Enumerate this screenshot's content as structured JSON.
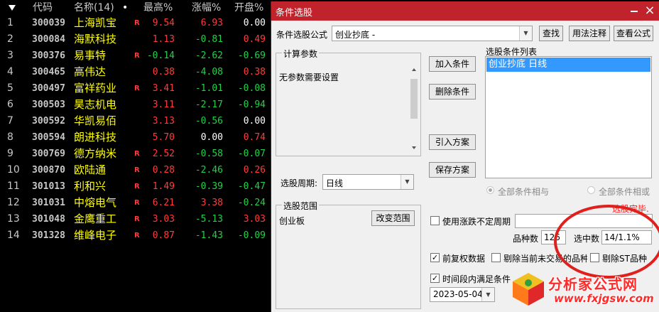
{
  "table": {
    "headers": {
      "code": "代码",
      "name": "名称(14)",
      "high": "最高%",
      "pct": "涨幅%",
      "open": "开盘%"
    },
    "rows": [
      {
        "idx": "1",
        "code": "300039",
        "name": "上海凯宝",
        "r": "R",
        "high": "9.54",
        "pct": "6.93",
        "open": "0.00",
        "hc": "red",
        "pc": "red",
        "oc": "white"
      },
      {
        "idx": "2",
        "code": "300084",
        "name": "海默科技",
        "r": "",
        "high": "1.13",
        "pct": "-0.81",
        "open": "0.49",
        "hc": "red",
        "pc": "green",
        "oc": "red"
      },
      {
        "idx": "3",
        "code": "300376",
        "name": "易事特",
        "r": "R",
        "high": "-0.14",
        "pct": "-2.62",
        "open": "-0.69",
        "hc": "green",
        "pc": "green",
        "oc": "green"
      },
      {
        "idx": "4",
        "code": "300465",
        "name": "高伟达",
        "r": "",
        "high": "0.38",
        "pct": "-4.08",
        "open": "0.38",
        "hc": "red",
        "pc": "green",
        "oc": "red"
      },
      {
        "idx": "5",
        "code": "300497",
        "name": "富祥药业",
        "r": "R",
        "high": "3.41",
        "pct": "-1.01",
        "open": "-0.08",
        "hc": "red",
        "pc": "green",
        "oc": "green"
      },
      {
        "idx": "6",
        "code": "300503",
        "name": "昊志机电",
        "r": "",
        "high": "3.11",
        "pct": "-2.17",
        "open": "-0.94",
        "hc": "red",
        "pc": "green",
        "oc": "green"
      },
      {
        "idx": "7",
        "code": "300592",
        "name": "华凯易佰",
        "r": "",
        "high": "3.13",
        "pct": "-0.56",
        "open": "0.00",
        "hc": "red",
        "pc": "green",
        "oc": "white"
      },
      {
        "idx": "8",
        "code": "300594",
        "name": "朗进科技",
        "r": "",
        "high": "5.70",
        "pct": "0.00",
        "open": "0.74",
        "hc": "red",
        "pc": "white",
        "oc": "red"
      },
      {
        "idx": "9",
        "code": "300769",
        "name": "德方纳米",
        "r": "R",
        "high": "2.52",
        "pct": "-0.58",
        "open": "-0.07",
        "hc": "red",
        "pc": "green",
        "oc": "green"
      },
      {
        "idx": "10",
        "code": "300870",
        "name": "欧陆通",
        "r": "R",
        "high": "0.28",
        "pct": "-2.46",
        "open": "0.26",
        "hc": "red",
        "pc": "green",
        "oc": "red"
      },
      {
        "idx": "11",
        "code": "301013",
        "name": "利和兴",
        "r": "R",
        "high": "1.49",
        "pct": "-0.39",
        "open": "-0.47",
        "hc": "red",
        "pc": "green",
        "oc": "green"
      },
      {
        "idx": "12",
        "code": "301031",
        "name": "中熔电气",
        "r": "R",
        "high": "6.21",
        "pct": "3.38",
        "open": "-0.24",
        "hc": "red",
        "pc": "red",
        "oc": "green"
      },
      {
        "idx": "13",
        "code": "301048",
        "name": "金鹰重工",
        "r": "R",
        "high": "3.03",
        "pct": "-5.13",
        "open": "3.03",
        "hc": "red",
        "pc": "green",
        "oc": "red"
      },
      {
        "idx": "14",
        "code": "301328",
        "name": "维峰电子",
        "r": "R",
        "high": "0.87",
        "pct": "-1.43",
        "open": "-0.09",
        "hc": "red",
        "pc": "green",
        "oc": "green"
      }
    ]
  },
  "dialog": {
    "title": "条件选股",
    "formula_label": "条件选股公式",
    "formula_value": "创业抄底    -",
    "find_btn": "查找",
    "usage_btn": "用法注释",
    "view_btn": "查看公式",
    "params_title": "计算参数",
    "params_text": "无参数需要设置",
    "add_btn": "加入条件",
    "remove_btn": "删除条件",
    "import_btn": "引入方案",
    "save_btn": "保存方案",
    "cond_list_title": "选股条件列表",
    "cond_items": [
      "创业抄底  日线"
    ],
    "period_label": "选股周期:",
    "period_value": "日线",
    "and_label": "全部条件相与",
    "or_label": "全部条件相或",
    "range_title": "选股范围",
    "range_value": "创业板",
    "change_range_btn": "改变范围",
    "status": "选股完毕.",
    "use_period_label": "使用涨跌不定周期",
    "count_label": "品种数",
    "count_value": "126",
    "selected_label": "选中数",
    "selected_value": "14/1.1%",
    "prerights_label": "前复权数据",
    "exclude_label": "剔除当前未交易的品种",
    "exclude_st_label": "剔除ST品种",
    "time_cond_label": "时间段内满足条件",
    "date_value": "2023-05-04",
    "close_icon": "×"
  },
  "watermark": {
    "line1": "分析家公式网",
    "line2": "www.fxjgsw.com"
  },
  "colors": {
    "up": "#ff3b3b",
    "down": "#22d04a",
    "title_bar": "#c0232b",
    "selection": "#3399ff",
    "annotation": "#e0201c"
  }
}
